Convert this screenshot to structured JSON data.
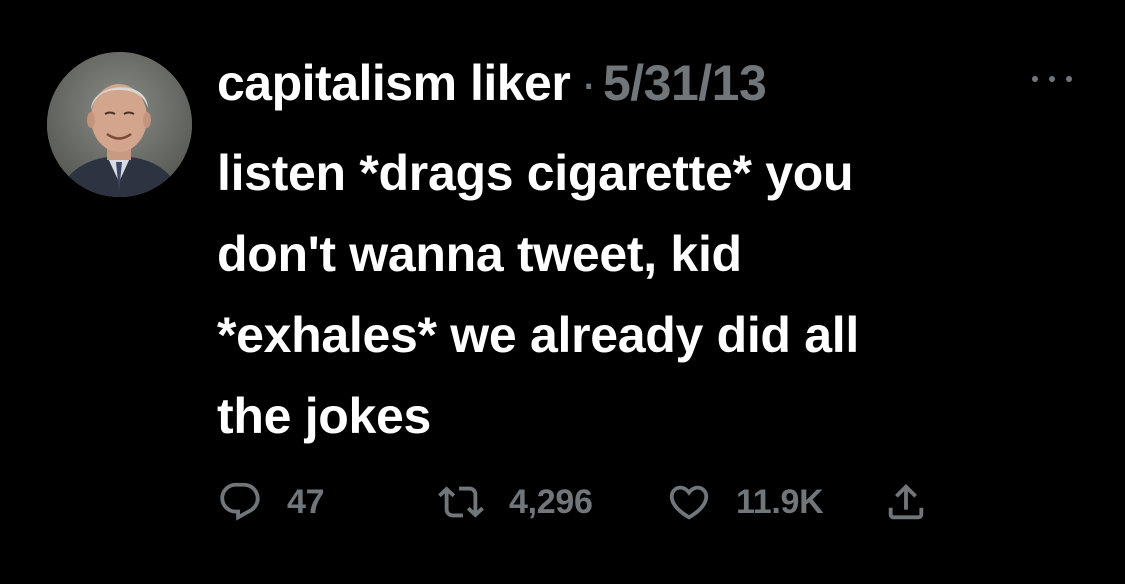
{
  "tweet": {
    "author": {
      "display_name": "capitalism liker",
      "avatar": "profile-photo-older-man"
    },
    "separator": "·",
    "timestamp": "5/31/13",
    "text_lines": [
      "listen *drags cigarette* you",
      "don't wanna tweet, kid",
      "*exhales* we already did all",
      "the jokes"
    ],
    "actions": {
      "replies": "47",
      "retweets": "4,296",
      "likes": "11.9K"
    },
    "icons": {
      "more": "more-horizontal-icon",
      "reply": "reply-bubble-icon",
      "retweet": "retweet-arrows-icon",
      "like": "heart-outline-icon",
      "share": "share-upload-icon"
    }
  },
  "colors": {
    "background": "#000000",
    "primary_text": "#ffffff",
    "secondary_text": "#71767b"
  }
}
